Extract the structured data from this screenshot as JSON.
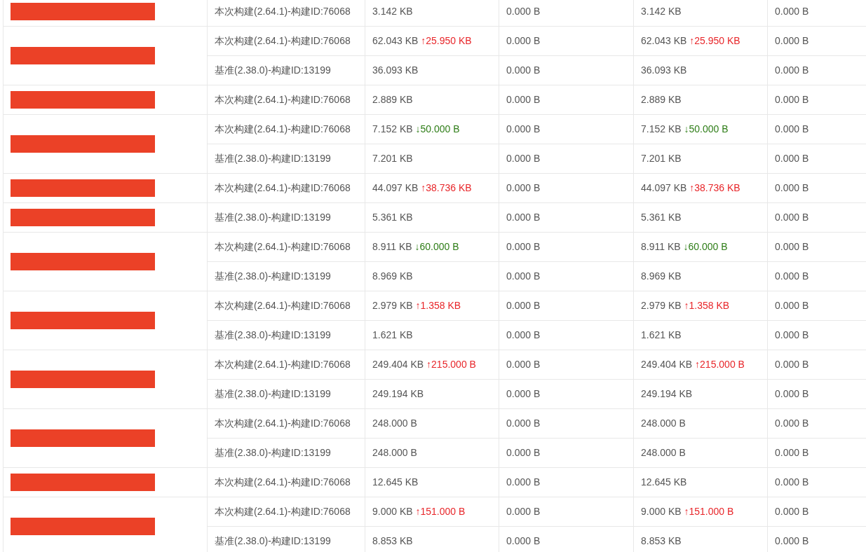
{
  "groups": [
    {
      "rows": [
        {
          "build": "本次构建(2.64.1)-构建ID:76068",
          "size": "3.142 KB",
          "col_3": "0.000 B",
          "size_2": "3.142 KB",
          "col_5": "0.000 B"
        }
      ]
    },
    {
      "rows": [
        {
          "build": "本次构建(2.64.1)-构建ID:76068",
          "size": "62.043 KB",
          "delta": {
            "increased": true,
            "text": "↑25.950 KB"
          },
          "col_3": "0.000 B",
          "size_2": "62.043 KB",
          "delta_2": {
            "increased": true,
            "text": "↑25.950 KB"
          },
          "col_5": "0.000 B"
        },
        {
          "build": "基准(2.38.0)-构建ID:13199",
          "size": "36.093 KB",
          "col_3": "0.000 B",
          "size_2": "36.093 KB",
          "col_5": "0.000 B"
        }
      ]
    },
    {
      "rows": [
        {
          "build": "本次构建(2.64.1)-构建ID:76068",
          "size": "2.889 KB",
          "col_3": "0.000 B",
          "size_2": "2.889 KB",
          "col_5": "0.000 B"
        }
      ]
    },
    {
      "rows": [
        {
          "build": "本次构建(2.64.1)-构建ID:76068",
          "size": "7.152 KB",
          "delta": {
            "increased": false,
            "text": "↓50.000 B"
          },
          "col_3": "0.000 B",
          "size_2": "7.152 KB",
          "delta_2": {
            "increased": false,
            "text": "↓50.000 B"
          },
          "col_5": "0.000 B"
        },
        {
          "build": "基准(2.38.0)-构建ID:13199",
          "size": "7.201 KB",
          "col_3": "0.000 B",
          "size_2": "7.201 KB",
          "col_5": "0.000 B"
        }
      ]
    },
    {
      "rows": [
        {
          "build": "本次构建(2.64.1)-构建ID:76068",
          "size": "44.097 KB",
          "delta": {
            "increased": true,
            "text": "↑38.736 KB"
          },
          "col_3": "0.000 B",
          "size_2": "44.097 KB",
          "delta_2": {
            "increased": true,
            "text": "↑38.736 KB"
          },
          "col_5": "0.000 B"
        }
      ]
    },
    {
      "rows": [
        {
          "build": "基准(2.38.0)-构建ID:13199",
          "size": "5.361 KB",
          "col_3": "0.000 B",
          "size_2": "5.361 KB",
          "col_5": "0.000 B"
        }
      ]
    },
    {
      "rows": [
        {
          "build": "本次构建(2.64.1)-构建ID:76068",
          "size": "8.911 KB",
          "delta": {
            "increased": false,
            "text": "↓60.000 B"
          },
          "col_3": "0.000 B",
          "size_2": "8.911 KB",
          "delta_2": {
            "increased": false,
            "text": "↓60.000 B"
          },
          "col_5": "0.000 B"
        },
        {
          "build": "基准(2.38.0)-构建ID:13199",
          "size": "8.969 KB",
          "col_3": "0.000 B",
          "size_2": "8.969 KB",
          "col_5": "0.000 B"
        }
      ]
    },
    {
      "rows": [
        {
          "build": "本次构建(2.64.1)-构建ID:76068",
          "size": "2.979 KB",
          "delta": {
            "increased": true,
            "text": "↑1.358 KB"
          },
          "col_3": "0.000 B",
          "size_2": "2.979 KB",
          "delta_2": {
            "increased": true,
            "text": "↑1.358 KB"
          },
          "col_5": "0.000 B"
        },
        {
          "build": "基准(2.38.0)-构建ID:13199",
          "size": "1.621 KB",
          "col_3": "0.000 B",
          "size_2": "1.621 KB",
          "col_5": "0.000 B"
        }
      ]
    },
    {
      "rows": [
        {
          "build": "本次构建(2.64.1)-构建ID:76068",
          "size": "249.404 KB",
          "delta": {
            "increased": true,
            "text": "↑215.000 B"
          },
          "col_3": "0.000 B",
          "size_2": "249.404 KB",
          "delta_2": {
            "increased": true,
            "text": "↑215.000 B"
          },
          "col_5": "0.000 B"
        },
        {
          "build": "基准(2.38.0)-构建ID:13199",
          "size": "249.194 KB",
          "col_3": "0.000 B",
          "size_2": "249.194 KB",
          "col_5": "0.000 B"
        }
      ]
    },
    {
      "rows": [
        {
          "build": "本次构建(2.64.1)-构建ID:76068",
          "size": "248.000 B",
          "col_3": "0.000 B",
          "size_2": "248.000 B",
          "col_5": "0.000 B"
        },
        {
          "build": "基准(2.38.0)-构建ID:13199",
          "size": "248.000 B",
          "col_3": "0.000 B",
          "size_2": "248.000 B",
          "col_5": "0.000 B"
        }
      ]
    },
    {
      "rows": [
        {
          "build": "本次构建(2.64.1)-构建ID:76068",
          "size": "12.645 KB",
          "col_3": "0.000 B",
          "size_2": "12.645 KB",
          "col_5": "0.000 B"
        }
      ]
    },
    {
      "rows": [
        {
          "build": "本次构建(2.64.1)-构建ID:76068",
          "size": "9.000 KB",
          "delta": {
            "increased": true,
            "text": "↑151.000 B"
          },
          "col_3": "0.000 B",
          "size_2": "9.000 KB",
          "delta_2": {
            "increased": true,
            "text": "↑151.000 B"
          },
          "col_5": "0.000 B"
        },
        {
          "build": "基准(2.38.0)-构建ID:13199",
          "size": "8.853 KB",
          "col_3": "0.000 B",
          "size_2": "8.853 KB",
          "col_5": "0.000 B"
        }
      ]
    }
  ]
}
